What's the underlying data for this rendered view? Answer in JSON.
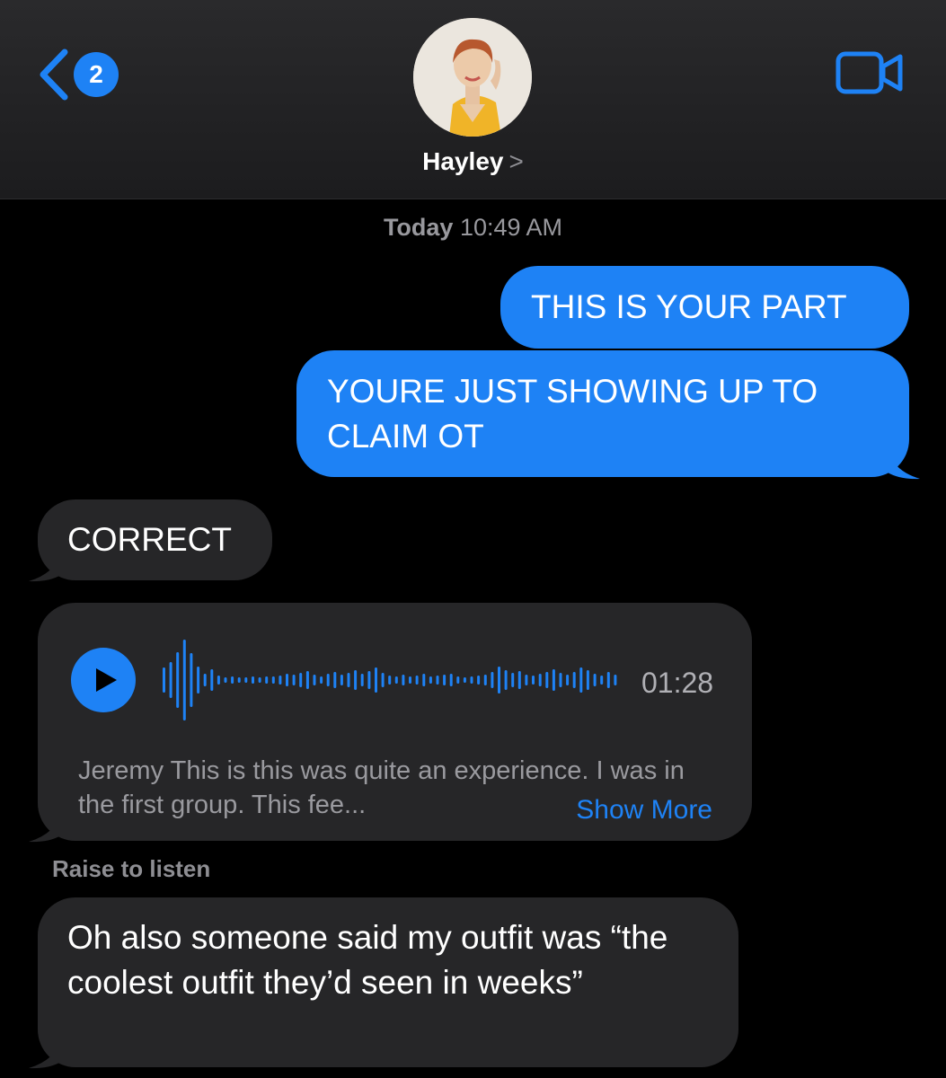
{
  "header": {
    "unread_count": "2",
    "contact_name": "Hayley",
    "contact_chevron": ">",
    "icons": {
      "back": "chevron-left-icon",
      "video": "video-camera-icon",
      "play": "play-icon"
    },
    "accent_color": "#1e82f5"
  },
  "thread": {
    "timestamp_day": "Today",
    "timestamp_time": "10:49 AM",
    "messages": [
      {
        "direction": "sent",
        "text": "THIS IS YOUR PART"
      },
      {
        "direction": "sent",
        "text": "YOURE JUST SHOWING UP TO CLAIM OT"
      },
      {
        "direction": "received",
        "text": "CORRECT"
      },
      {
        "direction": "received",
        "type": "audio",
        "duration": "01:28",
        "transcript": "Jeremy This is this was quite an experience. I was in the first group. This fee...",
        "show_more": "Show More"
      },
      {
        "direction": "received",
        "text": "Oh also someone said my outfit was “the coolest outfit they’d seen in weeks”"
      }
    ],
    "raise_to_listen": "Raise to listen"
  },
  "colors": {
    "sent_bubble": "#1e82f5",
    "received_bubble": "#262628",
    "background": "#000000"
  }
}
